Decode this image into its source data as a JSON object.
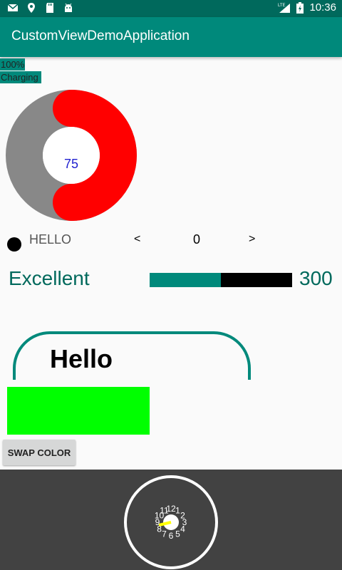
{
  "status_bar": {
    "icons_left": [
      "gmail-icon",
      "location-icon",
      "sd-card-icon",
      "android-icon"
    ],
    "network": "LTE",
    "time": "10:36"
  },
  "app_bar": {
    "title": "CustomViewDemoApplication"
  },
  "battery": {
    "percent_label": "100%",
    "status_label": "Charging"
  },
  "donut": {
    "value_label": "75",
    "fraction": 0.5,
    "colors": {
      "fill": "#ff0000",
      "track": "#888888",
      "center": "#ffffff"
    }
  },
  "row": {
    "hello_label": "HELLO",
    "prev_label": "<",
    "counter": "0",
    "next_label": ">"
  },
  "rating": {
    "label": "Excellent",
    "value": "300",
    "fill_fraction": 0.5,
    "fill_color": "#00897b",
    "track_color": "#000000"
  },
  "card": {
    "title": "Hello",
    "border_color": "#00897b"
  },
  "color_box": {
    "color": "#00ff00"
  },
  "swap_button": {
    "label": "SWAP COLOR"
  },
  "clock": {
    "numbers": [
      "12",
      "1",
      "2",
      "3",
      "4",
      "5",
      "6",
      "7",
      "8",
      "9",
      "10",
      "11"
    ],
    "hand_color": "#ffff00",
    "ring_color": "#ffffff"
  }
}
